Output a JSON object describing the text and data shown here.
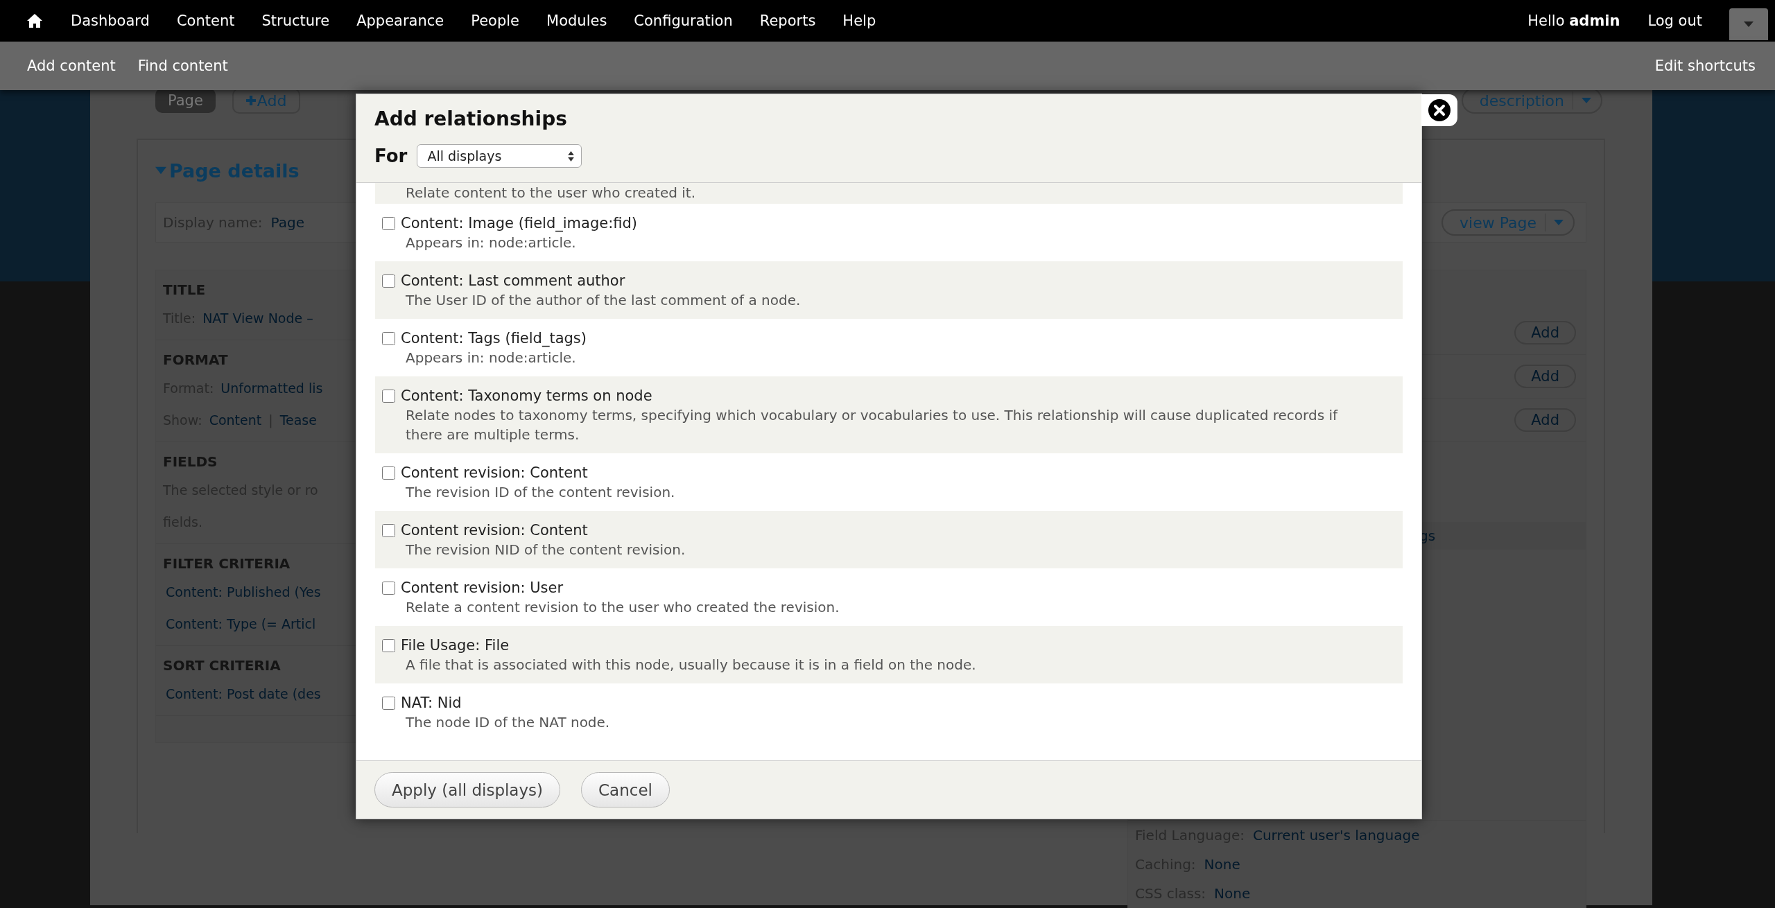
{
  "toolbar": {
    "menu": [
      "Dashboard",
      "Content",
      "Structure",
      "Appearance",
      "People",
      "Modules",
      "Configuration",
      "Reports",
      "Help"
    ],
    "greeting": "Hello **admin**",
    "logout": "Log out"
  },
  "shortcuts": {
    "items": [
      "Add content",
      "Find content"
    ],
    "edit": "Edit shortcuts"
  },
  "page": {
    "display_tabs": [
      {
        "label": "Page",
        "selected": true
      }
    ],
    "add_display": "Add",
    "top_right_button": "description",
    "details_toggle": {
      "label": "Page details",
      "expanded": true
    },
    "display_name": {
      "label": "Display name:",
      "value": "Page"
    },
    "view_button": "view Page",
    "sections": [
      {
        "heading": "TITLE",
        "lines": [
          {
            "kind": "setting",
            "label": "Title:",
            "values": [
              "NAT View Node –"
            ]
          }
        ]
      },
      {
        "heading": "FORMAT",
        "lines": [
          {
            "kind": "setting",
            "label": "Format:",
            "values": [
              "Unformatted lis"
            ]
          },
          {
            "kind": "setting",
            "label": "Show:",
            "values": [
              "Content",
              "Tease"
            ],
            "separator": "|"
          }
        ]
      },
      {
        "heading": "FIELDS",
        "lines": [
          {
            "kind": "text",
            "text": "The selected style or ro"
          },
          {
            "kind": "text",
            "text": "fields."
          }
        ]
      },
      {
        "heading": "FILTER CRITERIA",
        "lines": [
          {
            "kind": "link",
            "text": "Content: Published (Yes"
          },
          {
            "kind": "link",
            "text": "Content: Type (= Articl"
          }
        ]
      },
      {
        "heading": "SORT CRITERIA",
        "lines": [
          {
            "kind": "link",
            "text": "Content: Post date (des"
          }
        ]
      }
    ],
    "side": {
      "add_buttons": [
        "Add",
        "Add",
        "Add"
      ],
      "fragment": "gs",
      "settings": [
        {
          "label": "Field Language:",
          "value": "Current user's language"
        },
        {
          "label": "Caching:",
          "value": "None"
        },
        {
          "label": "CSS class:",
          "value": "None"
        }
      ]
    }
  },
  "dialog": {
    "title": "Add relationships",
    "for_label": "For",
    "display_select": "All displays",
    "items": [
      {
        "description": "Relate content to the user who created it."
      },
      {
        "label": "Content: Image (field_image:fid)",
        "description": "Appears in: node:article.",
        "checked": false
      },
      {
        "label": "Content: Last comment author",
        "description": "The User ID of the author of the last comment of a node.",
        "checked": false
      },
      {
        "label": "Content: Tags (field_tags)",
        "description": "Appears in: node:article.",
        "checked": false
      },
      {
        "label": "Content: Taxonomy terms on node",
        "description": "Relate nodes to taxonomy terms, specifying which vocabulary or vocabularies to use. This relationship will cause duplicated records if there are multiple terms.",
        "checked": false
      },
      {
        "label": "Content revision: Content",
        "description": "The revision ID of the content revision.",
        "checked": false
      },
      {
        "label": "Content revision: Content",
        "description": "The revision NID of the content revision.",
        "checked": false
      },
      {
        "label": "Content revision: User",
        "description": "Relate a content revision to the user who created the revision.",
        "checked": false
      },
      {
        "label": "File Usage: File",
        "description": "A file that is associated with this node, usually because it is in a field on the node.",
        "checked": false
      },
      {
        "label": "NAT: Nid",
        "description": "The node ID of the NAT node.",
        "checked": false
      }
    ],
    "buttons": [
      {
        "label": "Apply (all displays)"
      },
      {
        "label": "Cancel"
      }
    ]
  }
}
